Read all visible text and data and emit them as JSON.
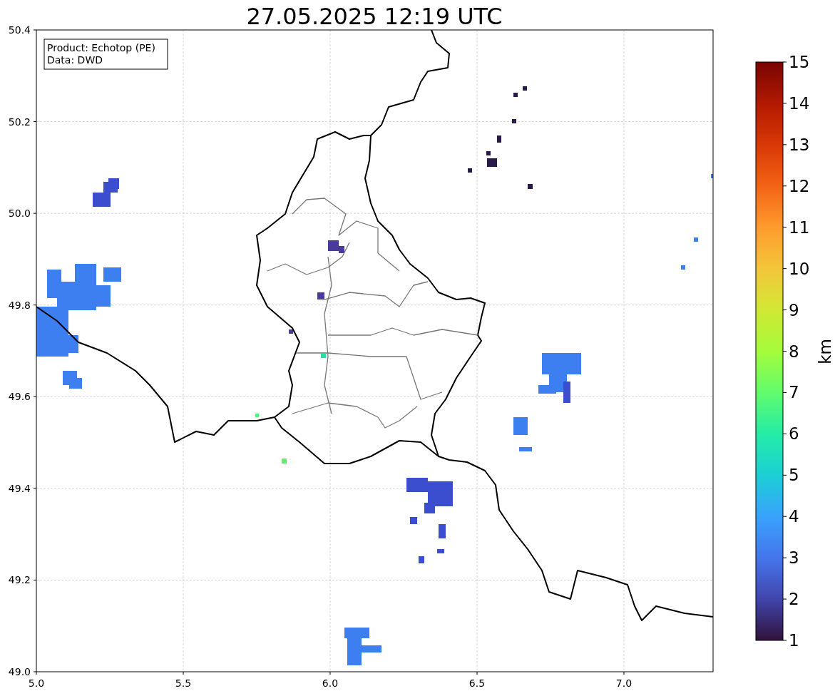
{
  "title": "27.05.2025 12:19 UTC",
  "legend": [
    "Product: Echotop (PE)",
    "Data: DWD"
  ],
  "map": {
    "y_ticks": [
      "50.4",
      "50.2",
      "50.0",
      "49.8",
      "49.6",
      "49.4",
      "49.2",
      "49.0"
    ],
    "x_ticks": [
      "5.0",
      "5.5",
      "6.0",
      "6.5",
      "7.0"
    ]
  },
  "colorbar": {
    "label": "km",
    "ticks": [
      "15",
      "14",
      "13",
      "12",
      "11",
      "10",
      "9",
      "8",
      "7",
      "6",
      "5",
      "4",
      "3",
      "2",
      "1"
    ]
  }
}
